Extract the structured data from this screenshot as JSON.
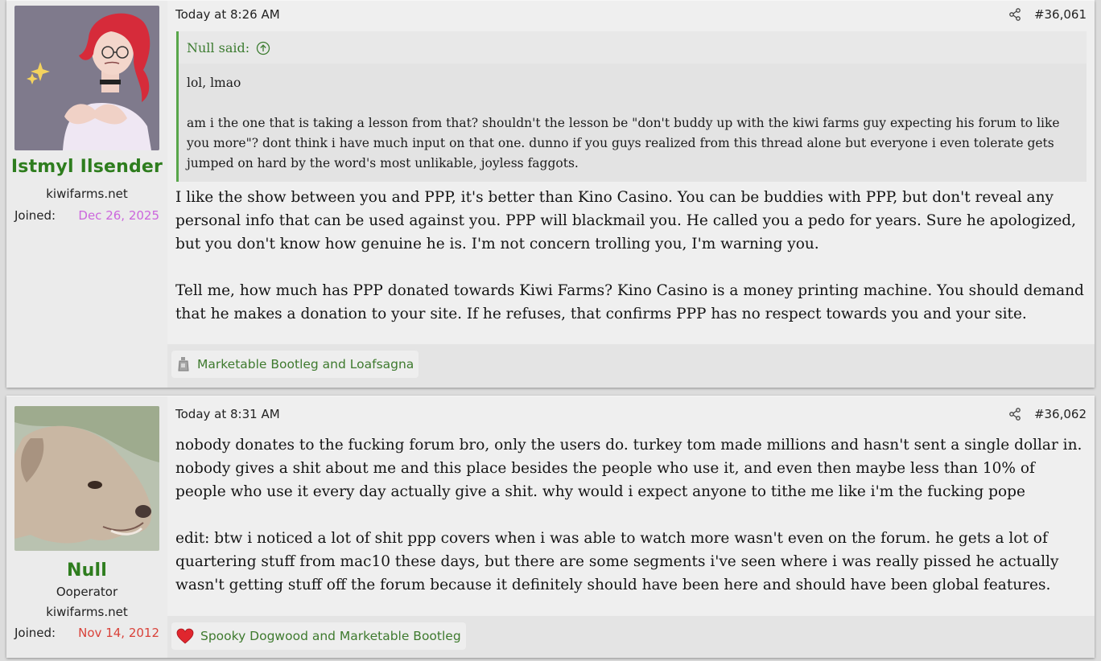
{
  "posts": [
    {
      "author": {
        "name": "Istmyl Ilsender",
        "site": "kiwifarms.net",
        "joined_label": "Joined:",
        "joined_date": "Dec 26, 2025",
        "joined_color": "#cc66dd",
        "avatar": "red-haired-cartoon-woman-avatar"
      },
      "time": "Today at 8:26 AM",
      "number": "#36,061",
      "quote": {
        "attribution": "Null said:",
        "paragraphs": [
          "lol, lmao",
          "am i the one that is taking a lesson from that? shouldn't the lesson be \"don't buddy up with the kiwi farms guy expecting his forum to like you more\"? dont think i have much input on that one. dunno if you guys realized from this thread alone but everyone i even tolerate gets jumped on hard by the word's most unlikable, joyless faggots."
        ]
      },
      "paragraphs": [
        "I like the show between you and PPP, it's better than Kino Casino. You can be buddies with PPP, but don't reveal any personal info that can be used against you. PPP will blackmail you. He called you a pedo for years. Sure he apologized, but you don't know how genuine he is. I'm not concern trolling you, I'm warning you.",
        "Tell me, how much has PPP donated towards Kiwi Farms? Kino Casino is a money printing machine. You should demand that he makes a donation to your site. If he refuses, that confirms PPP has no respect towards you and your site."
      ],
      "reaction": {
        "icon": "gray-bottle-icon",
        "text": "Marketable Bootleg and Loafsagna"
      }
    },
    {
      "author": {
        "name": "Null",
        "title": "Ooperator",
        "site": "kiwifarms.net",
        "joined_label": "Joined:",
        "joined_date": "Nov 14, 2012",
        "joined_color": "#d9423a",
        "avatar": "dog-avatar"
      },
      "time": "Today at 8:31 AM",
      "number": "#36,062",
      "paragraphs": [
        "nobody donates to the fucking forum bro, only the users do. turkey tom made millions and hasn't sent a single dollar in. nobody gives a shit about me and this place besides the people who use it, and even then maybe less than 10% of people who use it every day actually give a shit. why would i expect anyone to tithe me like i'm the fucking pope",
        "edit: btw i noticed a lot of shit ppp covers when i was able to watch more wasn't even on the forum. he gets a lot of quartering stuff from mac10 these days, but there are some segments i've seen where i was really pissed he actually wasn't getting stuff off the forum because it definitely should have been here and should have been global features."
      ],
      "reaction": {
        "icon": "heart-icon",
        "text": "Spooky Dogwood and Marketable Bootleg"
      }
    }
  ],
  "colors": {
    "username": "#2e7d1e",
    "quote_border": "#58a64a",
    "link_green": "#3e7a2e"
  }
}
